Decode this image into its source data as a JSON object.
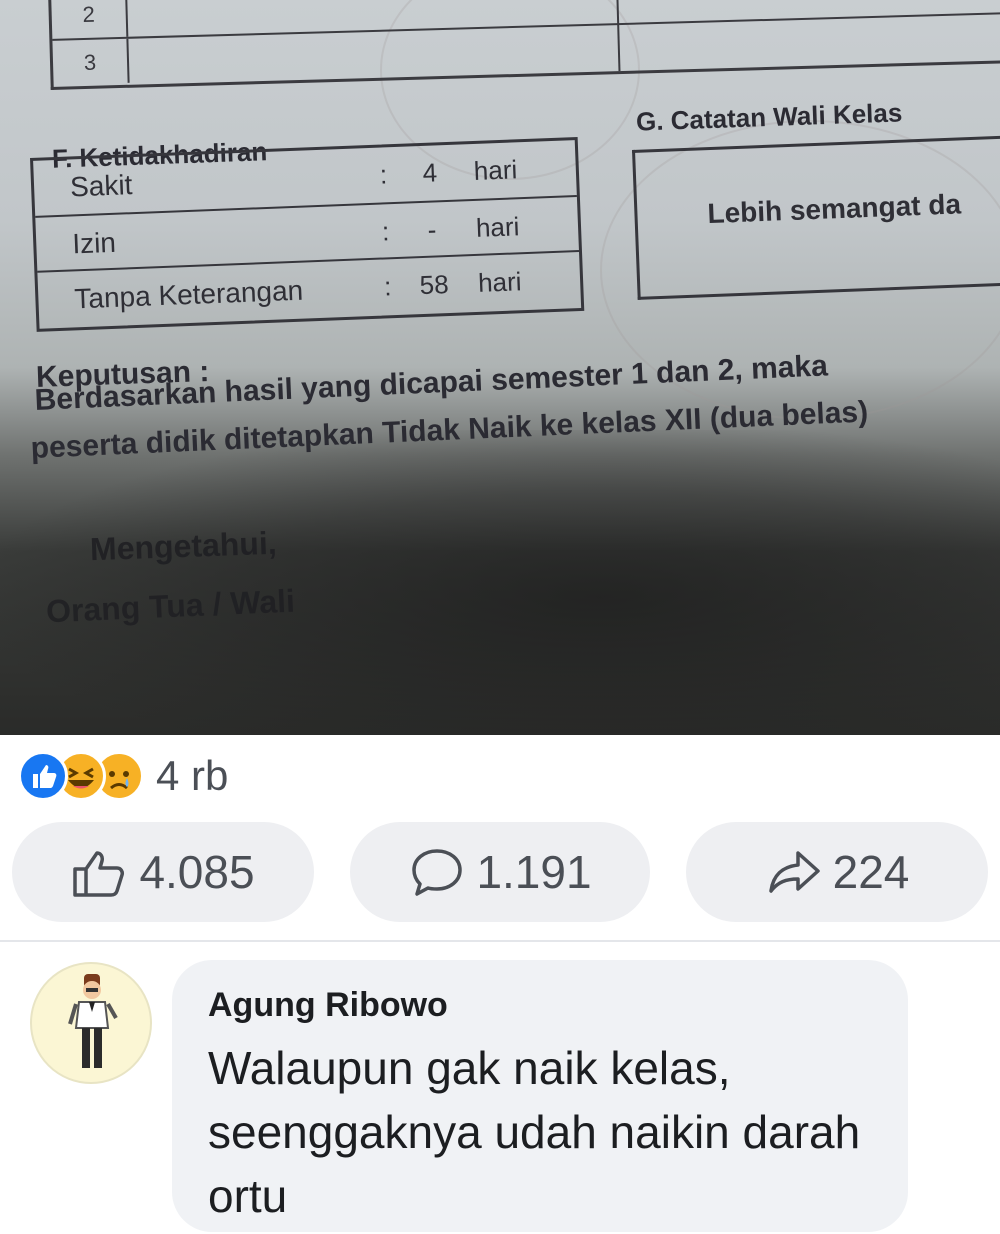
{
  "report": {
    "top_table_rows": [
      "2",
      "3"
    ],
    "absence_heading": "F. Ketidakhadiran",
    "absence_rows": [
      {
        "label": "Sakit",
        "value": "4",
        "unit": "hari"
      },
      {
        "label": "Izin",
        "value": "-",
        "unit": "hari"
      },
      {
        "label": "Tanpa Keterangan",
        "value": "58",
        "unit": "hari"
      }
    ],
    "notes_heading": "G. Catatan Wali Kelas",
    "notes_text": "Lebih semangat da",
    "decision_heading": "Keputusan :",
    "decision_line1": "Berdasarkan hasil yang dicapai semester 1 dan 2, maka",
    "decision_line2": "peserta didik ditetapkan Tidak Naik ke kelas XII (dua belas)",
    "sign_line1": "Mengetahui,",
    "sign_line2": "Orang Tua / Wali"
  },
  "reactions": {
    "count": "4 rb",
    "icons": [
      "like-reaction-icon",
      "haha-reaction-icon",
      "sad-reaction-icon"
    ]
  },
  "actions": {
    "like_count": "4.085",
    "comment_count": "1.191",
    "share_count": "224"
  },
  "comment": {
    "author": "Agung Ribowo",
    "text": "Walaupun gak naik kelas, seenggaknya udah naikin darah ortu"
  },
  "colors": {
    "like_blue": "#1877f2",
    "emoji_yellow": "#f7b125",
    "button_bg": "#eeeff2",
    "bubble_bg": "#f0f2f5"
  }
}
